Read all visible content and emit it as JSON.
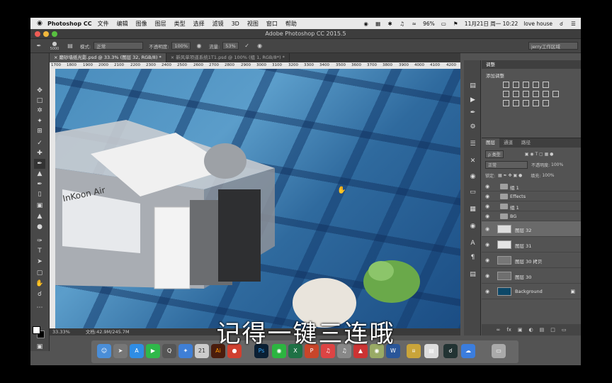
{
  "menubar": {
    "app_name": "Photoshop CC",
    "items": [
      "文件",
      "编辑",
      "图像",
      "图层",
      "类型",
      "选择",
      "滤镜",
      "3D",
      "视图",
      "窗口",
      "帮助"
    ],
    "battery": "96%",
    "datetime": "11月21日 周一  10:22",
    "user": "love house"
  },
  "window": {
    "title": "Adobe Photoshop CC 2015.5"
  },
  "options": {
    "brush_size": "5000",
    "mode_label": "模式:",
    "mode_value": "正常",
    "opacity_label": "不透明度:",
    "opacity_value": "100%",
    "flow_label": "流量:",
    "flow_value": "53%",
    "workspace": "jerry工作区域"
  },
  "tabs": [
    {
      "label": "磨砂墙纸光影.psd @ 33.3% (图层 32, RGB/8) *",
      "active": true
    },
    {
      "label": "新风单项道系统1T1.psd @ 100% (组 1, RGB/8*) *",
      "active": false
    }
  ],
  "ruler": {
    "ticks": [
      "1700",
      "1800",
      "1900",
      "2000",
      "2100",
      "2200",
      "2300",
      "2400",
      "2500",
      "2600",
      "2700",
      "2800",
      "2900",
      "3000",
      "3100",
      "3200",
      "3300",
      "3400",
      "3500",
      "3600",
      "3700",
      "3800",
      "3900",
      "4000",
      "4100",
      "4200"
    ]
  },
  "canvas": {
    "product_brand": "InKoon Air"
  },
  "status": {
    "zoom": "33.33%",
    "doc": "文档:42.9M/245.7M"
  },
  "adjustments": {
    "title": "调整",
    "add_label": "添加调整"
  },
  "layers": {
    "tabs": [
      "图层",
      "通道",
      "路径"
    ],
    "kind_label": "ρ 类型",
    "blend_mode": "正常",
    "opacity_label": "不透明度:",
    "opacity_value": "100%",
    "lock_label": "锁定:",
    "fill_label": "填充:",
    "fill_value": "100%",
    "items": [
      {
        "name": "组 1",
        "type": "group"
      },
      {
        "name": "Effects",
        "type": "group"
      },
      {
        "name": "组 1",
        "type": "group"
      },
      {
        "name": "BG",
        "type": "group"
      },
      {
        "name": "图层 32",
        "type": "layer",
        "selected": true
      },
      {
        "name": "图层 31",
        "type": "layer"
      },
      {
        "name": "图层 30 拷贝",
        "type": "layer"
      },
      {
        "name": "图层 30",
        "type": "layer"
      },
      {
        "name": "Background",
        "type": "layer"
      }
    ]
  },
  "subtitle": "记得一键三连哦",
  "colors": {
    "canvas_blue": "#2f6a9e",
    "ui_gray": "#535353",
    "bg_layer": "#0d4868"
  }
}
